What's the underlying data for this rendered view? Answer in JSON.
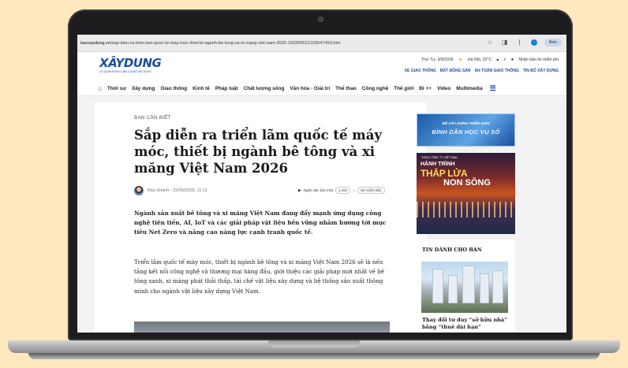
{
  "browser": {
    "url_domain": "baoxaydung.vn",
    "url_path": "/sap-dien-ra-trien-lam-quoc-te-may-moc-thiet-bi-nganh-be-tong-va-xi-mang-viet-nam-2026-192260522103647453.htm",
    "reload_label": "Relo"
  },
  "header": {
    "logo": "XÂYDUNG",
    "logo_sub": "CƠ QUAN NGÔN LUẬN CỦA BỘ XÂY DỰNG",
    "date": "Thứ Tư, 3/6/2026",
    "weather": "Hà Nội, 32°C",
    "newsletter": "Nhận bản tin miễn phí",
    "links": [
      "XE GIAO THÔNG",
      "BẤT ĐỘNG SẢN",
      "AN TOÀN GIAO THÔNG",
      "TIN BỘ XÂY DỰNG"
    ]
  },
  "nav": {
    "items": [
      "Thời sự",
      "Xây dựng",
      "Giao thông",
      "Kinh tế",
      "Pháp luật",
      "Chất lượng sống",
      "Văn hóa - Giải trí",
      "Thể thao",
      "Công nghệ",
      "Thế giới",
      "Đi ++",
      "Video",
      "Multimedia"
    ]
  },
  "article": {
    "category": "BẠN CẦN BIẾT",
    "title": "Sắp diễn ra triển lãm quốc tế máy móc, thiết bị ngành bê tông và xi măng Việt Nam 2026",
    "author": "Bảo Khanh",
    "date": "22/05/2026, 11:11",
    "audio_label": "Nghe đọc bài 2:52",
    "audio_speed": "1.00x",
    "audio_voice": "Nữ miền Bắc",
    "lead": "Ngành sản xuất bê tông và xi măng Việt Nam đang đẩy mạnh ứng dụng công nghệ tiên tiến, AI, IoT và các giải pháp vật liệu bền vững nhằm hướng tới mục tiêu Net Zero và nâng cao năng lực cạnh tranh quốc tế.",
    "body": "Triển lãm quốc tế máy móc, thiết bị ngành bê tông và xi măng Việt Nam 2026 sẽ là nền tảng kết nối công nghệ và thương mại hàng đầu, giới thiệu các giải pháp mới nhất về bê tông xanh, xi măng phát thải thấp, tái chế vật liệu xây dựng và hệ thống sản xuất thông minh cho ngành vật liệu xây dựng Việt Nam."
  },
  "sidebar": {
    "banner1_top": "BỘ XÂY DỰNG TRIỂN KHAI",
    "banner1_main": "BÌNH DÂN HỌC VỤ SỐ",
    "banner2_small": "TỔNG CÔNG TY VIỆT NAM",
    "banner2_a": "HÀNH TRÌNH",
    "banner2_b": "THẮP LỬA",
    "banner2_c": "NON SÔNG",
    "rec_title": "TIN DÀNH CHO BẠN",
    "rec_caption": "Thay đổi tư duy “sở hữu nhà” bằng “thuê dài hạn”"
  },
  "icons": [
    "star-icon",
    "extensions-icon",
    "profile-icon",
    "weather-icon",
    "location-icon",
    "user-icon",
    "home-icon",
    "menu-icon",
    "play-icon",
    "mic-icon"
  ],
  "colors": {
    "brand": "#1b4ea2",
    "background": "#ffe8bd"
  }
}
